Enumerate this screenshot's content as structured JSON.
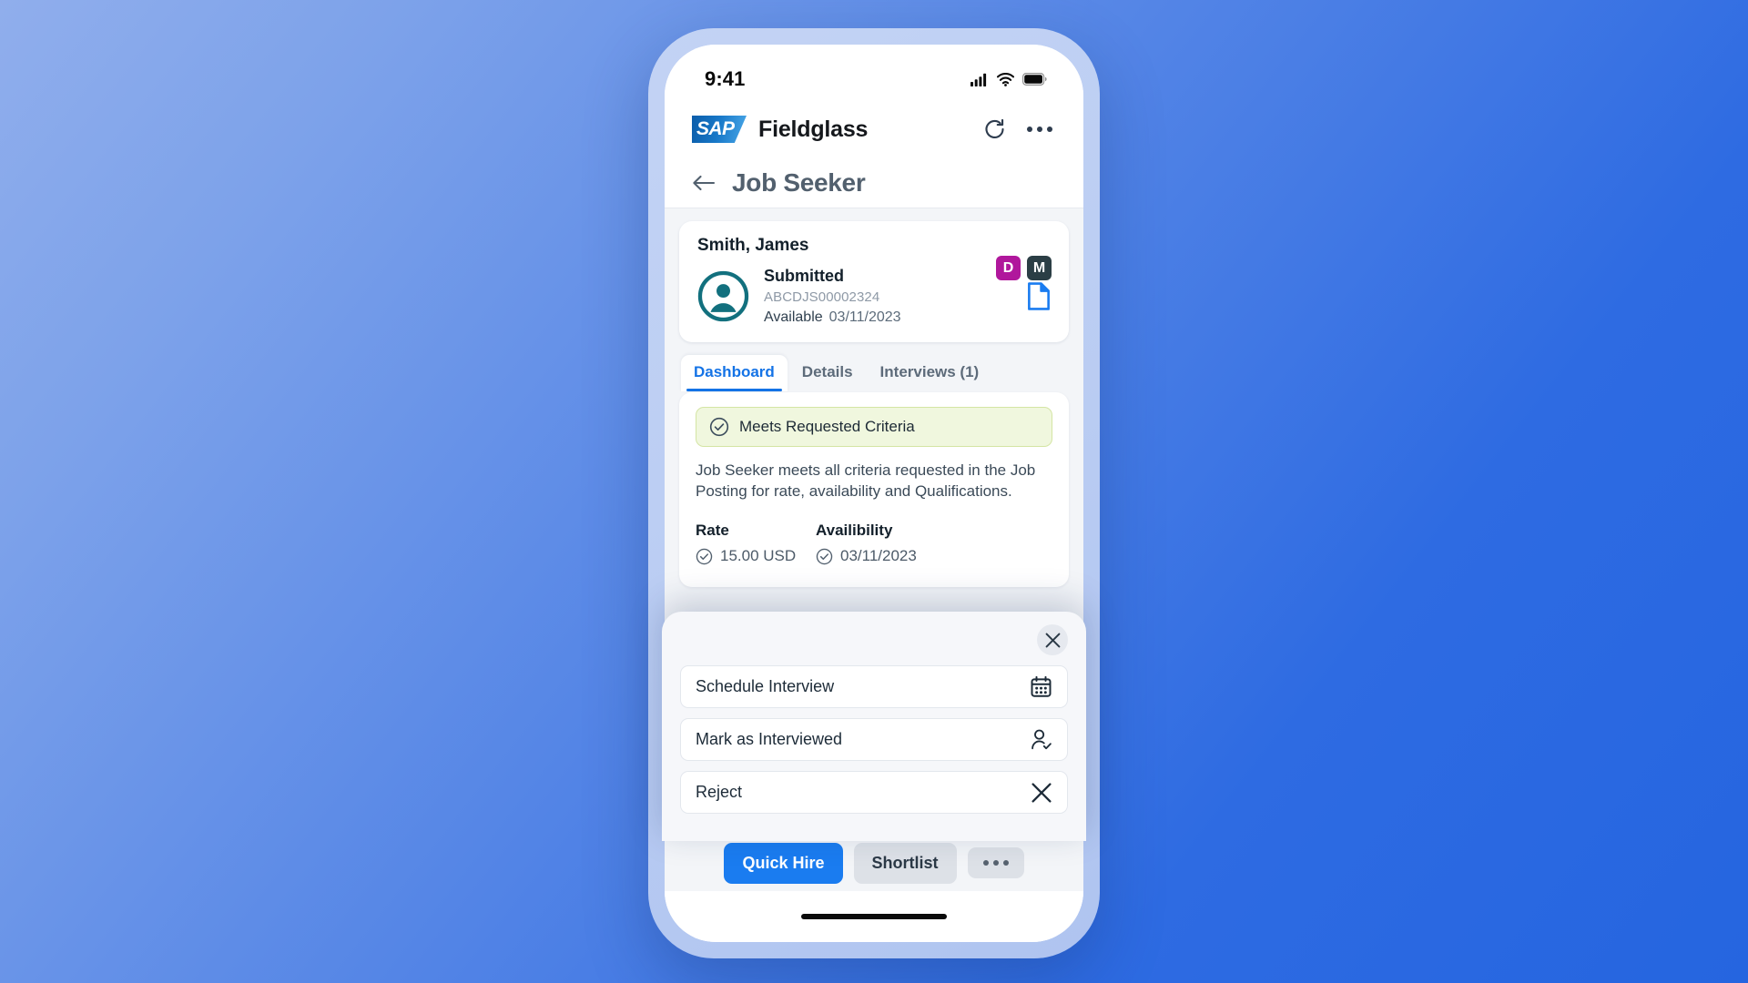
{
  "status_bar": {
    "time": "9:41",
    "icons": [
      "signal-icon",
      "wifi-icon",
      "battery-icon"
    ]
  },
  "app_bar": {
    "logo_text": "SAP",
    "brand_name": "Fieldglass",
    "refresh_label": "refresh-icon",
    "overflow_label": "overflow-menu-icon"
  },
  "page_header": {
    "back_label": "back-arrow-icon",
    "title": "Job Seeker"
  },
  "candidate": {
    "name": "Smith, James",
    "badges": [
      {
        "letter": "D",
        "color": "#B0179C"
      },
      {
        "letter": "M",
        "color": "#2B3E45"
      }
    ],
    "status": "Submitted",
    "id": "ABCDJS00002324",
    "available_label": "Available",
    "available_date": "03/11/2023",
    "document_icon": "document-icon",
    "avatar_color": "#12707E"
  },
  "tabs": [
    {
      "label": "Dashboard",
      "active": true
    },
    {
      "label": "Details",
      "active": false
    },
    {
      "label": "Interviews (1)",
      "active": false
    }
  ],
  "dashboard": {
    "banner_text": "Meets Requested Criteria",
    "banner_bg": "#F0F7DE",
    "description": "Job Seeker meets all criteria requested in the Job Posting for rate, availability and Qualifications.",
    "metrics": [
      {
        "label": "Rate",
        "value": "15.00 USD"
      },
      {
        "label": "Availibility",
        "value": "03/11/2023"
      }
    ]
  },
  "footer": {
    "primary_label": "Quick Hire",
    "secondary_label": "Shortlist",
    "more_label": "more-options-icon",
    "primary_color": "#1A7CF0"
  },
  "bottom_sheet": {
    "close_label": "close-icon",
    "actions": [
      {
        "label": "Schedule Interview",
        "icon": "calendar-icon"
      },
      {
        "label": "Mark as Interviewed",
        "icon": "person-check-icon"
      },
      {
        "label": "Reject",
        "icon": "close-x-icon"
      }
    ]
  }
}
